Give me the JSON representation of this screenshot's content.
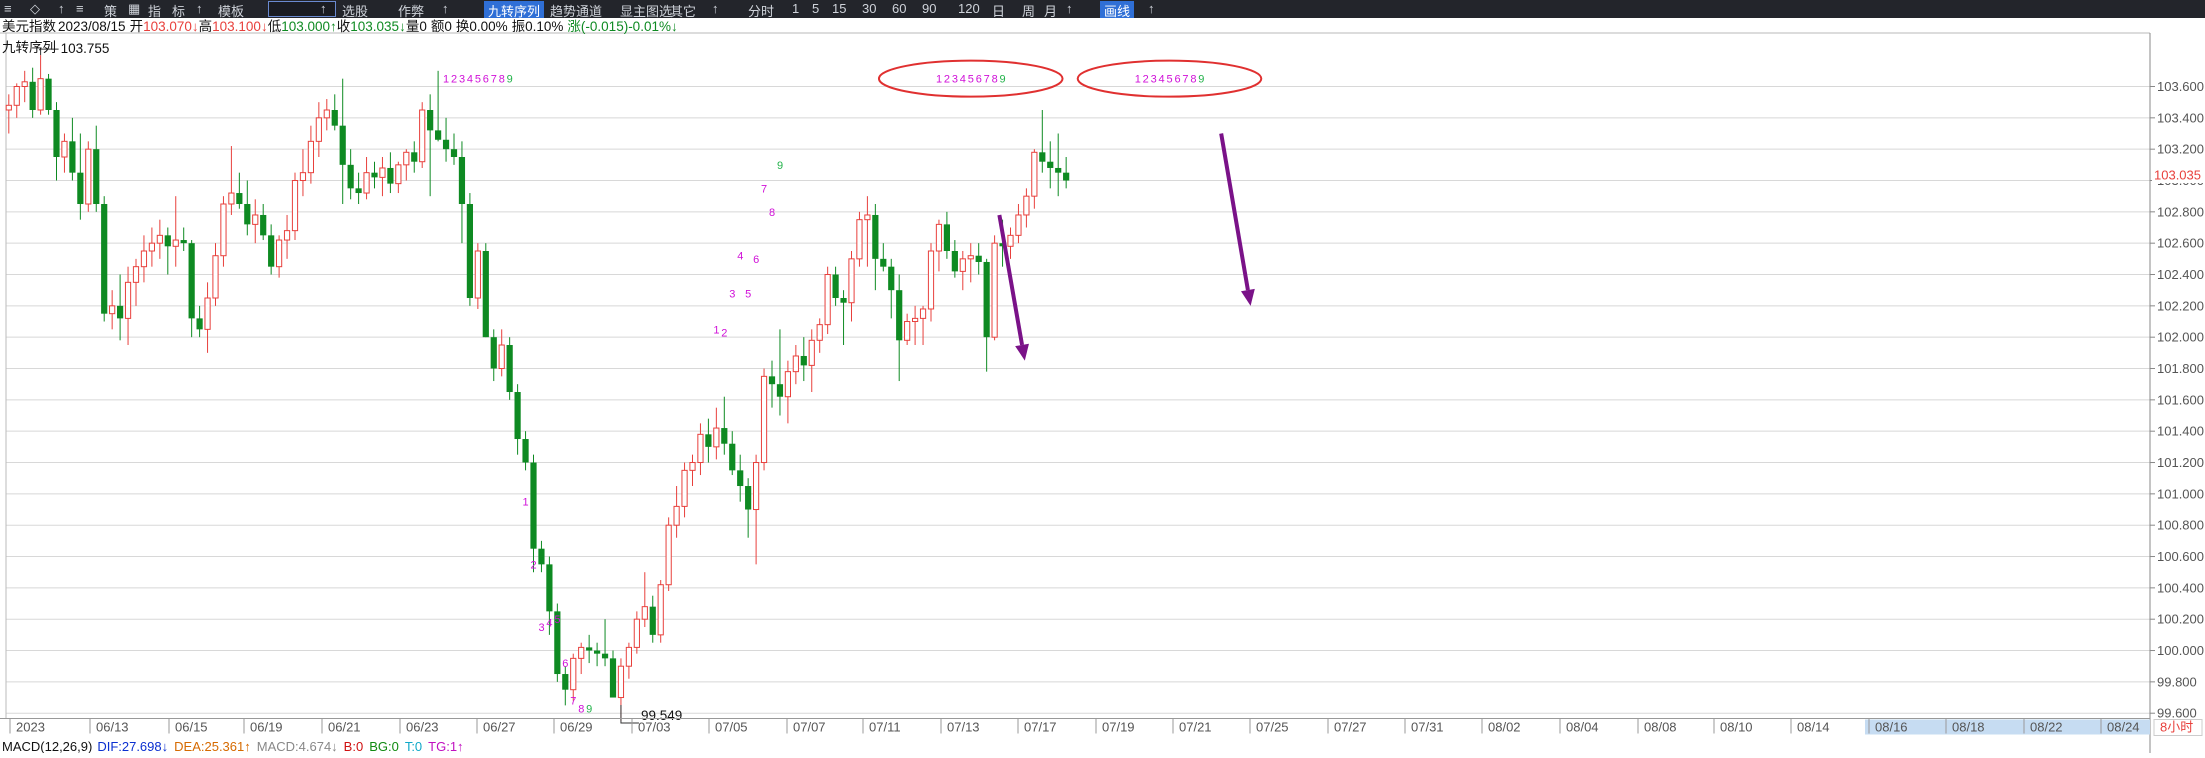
{
  "toolbar": {
    "items": [
      "≡",
      "◇",
      "↑",
      "≡",
      "策",
      "▦",
      "指",
      "标",
      "↑",
      "模板",
      "",
      "↑",
      "选股",
      "作弊",
      "↑",
      "九转序列",
      "趋势通道",
      "显主图选",
      "其它",
      "↑",
      "分时",
      "1",
      "5",
      "15",
      "30",
      "60",
      "90",
      "120",
      "日",
      "周",
      "月",
      "↑",
      "画线",
      "↑"
    ]
  },
  "header": {
    "name": "美元指数",
    "date": "2023/08/15",
    "open_label": "开",
    "open": "103.070",
    "high_label": "高",
    "high": "103.100",
    "low_label": "低",
    "low": "103.000",
    "close_label": "收",
    "close": "103.035",
    "vol_label": "量",
    "vol": "0",
    "amt_label": "额",
    "amt": "0",
    "turnover_label": "换",
    "turnover": "0.00%",
    "amp_label": "振",
    "amp": "0.10%",
    "chg_label": "涨",
    "chg": "(-0.015)-0.01%",
    "up_arrow": "↑",
    "down_arrow": "↓"
  },
  "indicator_name": "九转序列",
  "markers": {
    "high": "103.755",
    "low": "99.549"
  },
  "current_price": "103.035",
  "macd_line": {
    "name": "MACD(12,26,9)",
    "dif": "DIF:27.698↓",
    "dea": "DEA:25.361↑",
    "macd": "MACD:4.674↓",
    "b": "B:0",
    "bg": "BG:0",
    "t": "T:0",
    "tg": "TG:1↑"
  },
  "period_badge": "8小时",
  "colors": {
    "up": "#e8403c",
    "down": "#0e8a22",
    "grid": "#d8d8d8",
    "seq_magenta": "#d010d8",
    "seq_nine": "#22b24a",
    "ellipse": "#e03030",
    "arrow": "#7a1288",
    "toolbar_bg": "#23252b",
    "future_axis_bg": "#c6dcf2"
  },
  "chart_data": {
    "type": "candlestick",
    "ylim": [
      99.5,
      103.75
    ],
    "y_ticks": [
      "103.600",
      "103.400",
      "103.200",
      "103.000",
      "102.800",
      "102.600",
      "102.400",
      "102.200",
      "102.000",
      "101.800",
      "101.600",
      "101.400",
      "101.200",
      "101.000",
      "100.800",
      "100.600",
      "100.400",
      "100.200",
      "100.000",
      "99.800",
      "99.600"
    ],
    "x_ticks": [
      "2023",
      "06/13",
      "06/15",
      "06/19",
      "06/21",
      "06/23",
      "06/27",
      "06/29",
      "07/03",
      "07/05",
      "07/07",
      "07/11",
      "07/13",
      "07/17",
      "07/19",
      "07/21",
      "07/25",
      "07/27",
      "07/31",
      "08/02",
      "08/04",
      "08/08",
      "08/10",
      "08/14",
      "08/16",
      "08/18",
      "08/22",
      "08/24"
    ],
    "future_ticks_from_index": 24,
    "ohlc": [
      [
        103.45,
        103.55,
        103.3,
        103.48
      ],
      [
        103.48,
        103.62,
        103.4,
        103.6
      ],
      [
        103.6,
        103.7,
        103.5,
        103.63
      ],
      [
        103.63,
        103.72,
        103.4,
        103.45
      ],
      [
        103.45,
        103.8,
        103.42,
        103.65
      ],
      [
        103.65,
        103.68,
        103.42,
        103.45
      ],
      [
        103.45,
        103.5,
        103.0,
        103.15
      ],
      [
        103.15,
        103.3,
        103.05,
        103.25
      ],
      [
        103.25,
        103.4,
        103.0,
        103.05
      ],
      [
        103.05,
        103.3,
        102.75,
        102.85
      ],
      [
        102.85,
        103.25,
        102.8,
        103.2
      ],
      [
        103.2,
        103.35,
        102.8,
        102.85
      ],
      [
        102.85,
        102.9,
        102.1,
        102.15
      ],
      [
        102.15,
        102.3,
        102.05,
        102.2
      ],
      [
        102.2,
        102.4,
        101.98,
        102.12
      ],
      [
        102.12,
        102.45,
        101.95,
        102.35
      ],
      [
        102.35,
        102.5,
        102.2,
        102.45
      ],
      [
        102.45,
        102.65,
        102.35,
        102.55
      ],
      [
        102.55,
        102.7,
        102.45,
        102.6
      ],
      [
        102.6,
        102.75,
        102.5,
        102.65
      ],
      [
        102.65,
        102.7,
        102.4,
        102.58
      ],
      [
        102.58,
        102.9,
        102.45,
        102.62
      ],
      [
        102.62,
        102.7,
        102.55,
        102.6
      ],
      [
        102.6,
        102.62,
        102.0,
        102.12
      ],
      [
        102.12,
        102.2,
        102.0,
        102.05
      ],
      [
        102.05,
        102.35,
        101.9,
        102.25
      ],
      [
        102.25,
        102.6,
        102.2,
        102.52
      ],
      [
        102.52,
        102.9,
        102.45,
        102.85
      ],
      [
        102.85,
        103.22,
        102.78,
        102.92
      ],
      [
        102.92,
        103.05,
        102.82,
        102.85
      ],
      [
        102.85,
        103.0,
        102.65,
        102.72
      ],
      [
        102.72,
        102.88,
        102.6,
        102.78
      ],
      [
        102.78,
        102.85,
        102.62,
        102.65
      ],
      [
        102.65,
        102.72,
        102.4,
        102.45
      ],
      [
        102.45,
        102.65,
        102.38,
        102.62
      ],
      [
        102.62,
        102.78,
        102.5,
        102.68
      ],
      [
        102.68,
        103.05,
        102.62,
        103.0
      ],
      [
        103.0,
        103.2,
        102.9,
        103.05
      ],
      [
        103.05,
        103.35,
        102.98,
        103.25
      ],
      [
        103.25,
        103.5,
        103.15,
        103.4
      ],
      [
        103.4,
        103.52,
        103.32,
        103.45
      ],
      [
        103.45,
        103.55,
        103.32,
        103.35
      ],
      [
        103.35,
        103.65,
        102.85,
        103.1
      ],
      [
        103.1,
        103.2,
        102.88,
        102.95
      ],
      [
        102.95,
        103.05,
        102.85,
        102.92
      ],
      [
        102.92,
        103.15,
        102.88,
        103.05
      ],
      [
        103.05,
        103.12,
        102.95,
        103.02
      ],
      [
        103.02,
        103.15,
        102.9,
        103.08
      ],
      [
        103.08,
        103.18,
        102.92,
        102.98
      ],
      [
        102.98,
        103.12,
        102.92,
        103.1
      ],
      [
        103.1,
        103.2,
        103.0,
        103.18
      ],
      [
        103.18,
        103.25,
        103.05,
        103.12
      ],
      [
        103.12,
        103.5,
        103.08,
        103.45
      ],
      [
        103.45,
        103.55,
        102.9,
        103.32
      ],
      [
        103.32,
        103.7,
        103.25,
        103.26
      ],
      [
        103.26,
        103.4,
        103.12,
        103.2
      ],
      [
        103.2,
        103.3,
        103.1,
        103.15
      ],
      [
        103.15,
        103.25,
        102.6,
        102.85
      ],
      [
        102.85,
        102.92,
        102.2,
        102.25
      ],
      [
        102.25,
        102.6,
        102.18,
        102.55
      ],
      [
        102.55,
        102.6,
        102.0,
        102.0
      ],
      [
        102.0,
        102.05,
        101.72,
        101.8
      ],
      [
        101.8,
        102.05,
        101.75,
        101.95
      ],
      [
        101.95,
        102.0,
        101.6,
        101.65
      ],
      [
        101.65,
        101.7,
        101.25,
        101.35
      ],
      [
        101.35,
        101.4,
        101.15,
        101.2
      ],
      [
        101.2,
        101.25,
        100.5,
        100.65
      ],
      [
        100.65,
        100.7,
        100.5,
        100.55
      ],
      [
        100.55,
        100.6,
        100.1,
        100.25
      ],
      [
        100.25,
        100.3,
        99.8,
        99.85
      ],
      [
        99.85,
        99.9,
        99.65,
        99.75
      ],
      [
        99.75,
        99.98,
        99.68,
        99.95
      ],
      [
        99.95,
        100.05,
        99.85,
        100.02
      ],
      [
        100.02,
        100.1,
        99.92,
        100.0
      ],
      [
        100.0,
        100.05,
        99.9,
        99.98
      ],
      [
        99.98,
        100.2,
        99.9,
        99.95
      ],
      [
        99.95,
        100.0,
        99.75,
        99.7
      ],
      [
        99.7,
        99.95,
        99.55,
        99.9
      ],
      [
        99.9,
        100.05,
        99.82,
        100.02
      ],
      [
        100.02,
        100.25,
        99.98,
        100.2
      ],
      [
        100.2,
        100.5,
        100.15,
        100.28
      ],
      [
        100.28,
        100.35,
        100.05,
        100.1
      ],
      [
        100.1,
        100.45,
        100.05,
        100.42
      ],
      [
        100.42,
        100.85,
        100.38,
        100.8
      ],
      [
        100.8,
        101.05,
        100.72,
        100.92
      ],
      [
        100.92,
        101.2,
        100.85,
        101.15
      ],
      [
        101.15,
        101.25,
        101.05,
        101.2
      ],
      [
        101.2,
        101.45,
        101.12,
        101.38
      ],
      [
        101.38,
        101.48,
        101.2,
        101.3
      ],
      [
        101.3,
        101.55,
        101.22,
        101.42
      ],
      [
        101.42,
        101.62,
        101.25,
        101.32
      ],
      [
        101.32,
        101.4,
        101.12,
        101.15
      ],
      [
        101.15,
        101.25,
        100.95,
        101.05
      ],
      [
        101.05,
        101.1,
        100.72,
        100.9
      ],
      [
        100.9,
        101.25,
        100.55,
        101.2
      ],
      [
        101.2,
        101.8,
        101.15,
        101.75
      ],
      [
        101.75,
        101.85,
        101.55,
        101.7
      ],
      [
        101.7,
        102.05,
        101.5,
        101.62
      ],
      [
        101.62,
        101.85,
        101.45,
        101.78
      ],
      [
        101.78,
        101.95,
        101.7,
        101.88
      ],
      [
        101.88,
        102.0,
        101.72,
        101.82
      ],
      [
        101.82,
        102.05,
        101.65,
        101.98
      ],
      [
        101.98,
        102.12,
        101.9,
        102.08
      ],
      [
        102.08,
        102.45,
        102.02,
        102.4
      ],
      [
        102.4,
        102.45,
        102.2,
        102.25
      ],
      [
        102.25,
        102.3,
        101.95,
        102.22
      ],
      [
        102.22,
        102.55,
        102.1,
        102.5
      ],
      [
        102.5,
        102.8,
        102.45,
        102.75
      ],
      [
        102.75,
        102.9,
        102.45,
        102.78
      ],
      [
        102.78,
        102.85,
        102.3,
        102.5
      ],
      [
        102.5,
        102.6,
        102.42,
        102.45
      ],
      [
        102.45,
        102.5,
        102.12,
        102.3
      ],
      [
        102.3,
        102.4,
        101.72,
        101.98
      ],
      [
        101.98,
        102.15,
        101.95,
        102.1
      ],
      [
        102.1,
        102.2,
        101.95,
        102.12
      ],
      [
        102.12,
        102.2,
        101.95,
        102.18
      ],
      [
        102.18,
        102.6,
        102.1,
        102.55
      ],
      [
        102.55,
        102.75,
        102.42,
        102.72
      ],
      [
        102.72,
        102.8,
        102.5,
        102.55
      ],
      [
        102.55,
        102.62,
        102.38,
        102.42
      ],
      [
        102.42,
        102.55,
        102.3,
        102.5
      ],
      [
        102.5,
        102.6,
        102.35,
        102.52
      ],
      [
        102.52,
        102.6,
        102.4,
        102.48
      ],
      [
        102.48,
        102.5,
        101.78,
        102.0
      ],
      [
        102.0,
        102.65,
        101.98,
        102.6
      ],
      [
        102.6,
        102.75,
        102.45,
        102.58
      ],
      [
        102.58,
        102.7,
        102.5,
        102.65
      ],
      [
        102.65,
        102.85,
        102.6,
        102.78
      ],
      [
        102.78,
        102.95,
        102.7,
        102.9
      ],
      [
        102.9,
        103.2,
        102.82,
        103.18
      ],
      [
        103.18,
        103.45,
        103.05,
        103.12
      ],
      [
        103.12,
        103.25,
        102.95,
        103.08
      ],
      [
        103.08,
        103.3,
        102.9,
        103.05
      ],
      [
        103.05,
        103.15,
        102.95,
        103.0
      ]
    ],
    "seq_marks": [
      {
        "t": "1",
        "x": 55,
        "v": 103.65,
        "c": "m"
      },
      {
        "t": "2",
        "x": 56,
        "v": 103.65,
        "c": "m"
      },
      {
        "t": "3",
        "x": 57,
        "v": 103.65,
        "c": "m"
      },
      {
        "t": "4",
        "x": 58,
        "v": 103.65,
        "c": "m"
      },
      {
        "t": "5",
        "x": 59,
        "v": 103.65,
        "c": "m"
      },
      {
        "t": "6",
        "x": 60,
        "v": 103.65,
        "c": "m"
      },
      {
        "t": "7",
        "x": 61,
        "v": 103.65,
        "c": "m"
      },
      {
        "t": "8",
        "x": 62,
        "v": 103.65,
        "c": "m"
      },
      {
        "t": "9",
        "x": 63,
        "v": 103.65,
        "c": "g"
      },
      {
        "t": "1",
        "x": 65,
        "v": 100.95,
        "c": "m"
      },
      {
        "t": "2",
        "x": 66,
        "v": 100.55,
        "c": "m"
      },
      {
        "t": "3",
        "x": 67,
        "v": 100.15,
        "c": "m"
      },
      {
        "t": "4",
        "x": 68,
        "v": 100.18,
        "c": "m"
      },
      {
        "t": "5",
        "x": 69,
        "v": 100.2,
        "c": "m"
      },
      {
        "t": "6",
        "x": 70,
        "v": 99.92,
        "c": "m"
      },
      {
        "t": "7",
        "x": 71,
        "v": 99.68,
        "c": "m"
      },
      {
        "t": "8",
        "x": 72,
        "v": 99.63,
        "c": "m"
      },
      {
        "t": "9",
        "x": 73,
        "v": 99.63,
        "c": "g"
      },
      {
        "t": "1",
        "x": 89,
        "v": 102.05,
        "c": "m"
      },
      {
        "t": "2",
        "x": 90,
        "v": 102.03,
        "c": "m"
      },
      {
        "t": "3",
        "x": 91,
        "v": 102.28,
        "c": "m"
      },
      {
        "t": "4",
        "x": 92,
        "v": 102.52,
        "c": "m"
      },
      {
        "t": "5",
        "x": 93,
        "v": 102.28,
        "c": "m"
      },
      {
        "t": "6",
        "x": 94,
        "v": 102.5,
        "c": "m"
      },
      {
        "t": "7",
        "x": 95,
        "v": 102.95,
        "c": "m"
      },
      {
        "t": "8",
        "x": 96,
        "v": 102.8,
        "c": "m"
      },
      {
        "t": "9",
        "x": 97,
        "v": 103.1,
        "c": "g"
      },
      {
        "t": "1",
        "x": 117,
        "v": 103.65,
        "c": "m"
      },
      {
        "t": "2",
        "x": 118,
        "v": 103.65,
        "c": "m"
      },
      {
        "t": "3",
        "x": 119,
        "v": 103.65,
        "c": "m"
      },
      {
        "t": "4",
        "x": 120,
        "v": 103.65,
        "c": "m"
      },
      {
        "t": "5",
        "x": 121,
        "v": 103.65,
        "c": "m"
      },
      {
        "t": "6",
        "x": 122,
        "v": 103.65,
        "c": "m"
      },
      {
        "t": "7",
        "x": 123,
        "v": 103.65,
        "c": "m"
      },
      {
        "t": "8",
        "x": 124,
        "v": 103.65,
        "c": "m"
      },
      {
        "t": "9",
        "x": 125,
        "v": 103.65,
        "c": "g"
      },
      {
        "t": "1",
        "x": 142,
        "v": 103.65,
        "c": "m"
      },
      {
        "t": "2",
        "x": 143,
        "v": 103.65,
        "c": "m"
      },
      {
        "t": "3",
        "x": 144,
        "v": 103.65,
        "c": "m"
      },
      {
        "t": "4",
        "x": 145,
        "v": 103.65,
        "c": "m"
      },
      {
        "t": "5",
        "x": 146,
        "v": 103.65,
        "c": "m"
      },
      {
        "t": "6",
        "x": 147,
        "v": 103.65,
        "c": "m"
      },
      {
        "t": "7",
        "x": 148,
        "v": 103.65,
        "c": "m"
      },
      {
        "t": "8",
        "x": 149,
        "v": 103.65,
        "c": "m"
      },
      {
        "t": "9",
        "x": 150,
        "v": 103.65,
        "c": "g"
      }
    ],
    "highlight_ellipses": [
      {
        "from": 117,
        "to": 125,
        "v": 103.65
      },
      {
        "from": 142,
        "to": 150,
        "v": 103.65
      }
    ],
    "arrows": [
      {
        "x0": 124.6,
        "v0": 102.78,
        "x1": 127.8,
        "v1": 101.85
      },
      {
        "x0": 152.5,
        "v0": 103.3,
        "x1": 156.2,
        "v1": 102.2
      }
    ]
  }
}
